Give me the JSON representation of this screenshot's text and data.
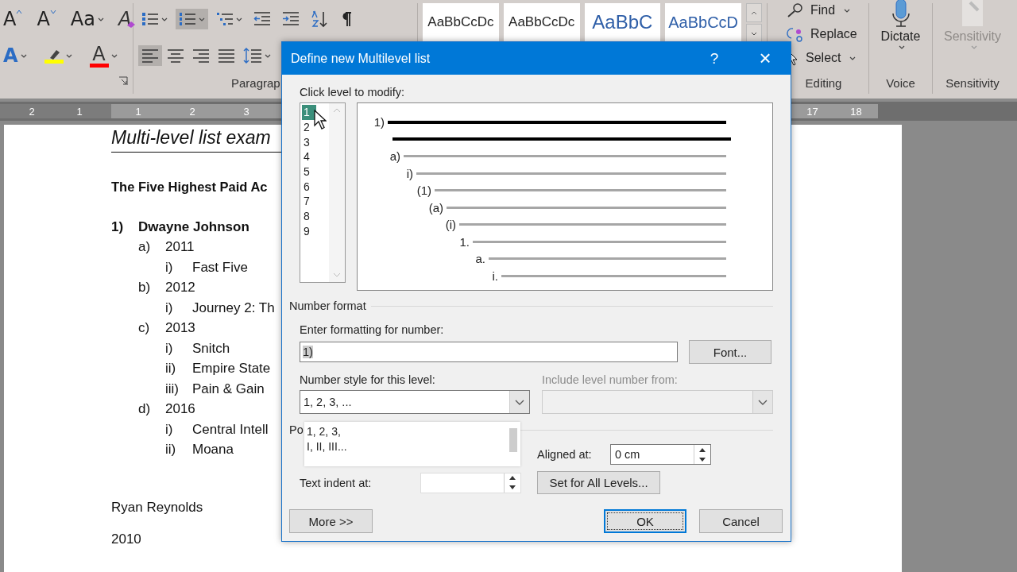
{
  "ribbon": {
    "font_buttons": [
      {
        "kind": "grow",
        "glyph": "A"
      },
      {
        "kind": "shrink",
        "glyph": "A"
      },
      {
        "kind": "case",
        "glyph": "Aa",
        "dropdown": true
      },
      {
        "kind": "clear",
        "glyph": "A"
      }
    ],
    "font_buttons_2": [
      {
        "kind": "effects",
        "glyph": "A",
        "dropdown": true
      },
      {
        "kind": "highlight",
        "dropdown": true,
        "color": "#ffff00"
      },
      {
        "kind": "font-color",
        "glyph": "A",
        "dropdown": true,
        "color": "#ff0000"
      }
    ],
    "paragraph_buttons": [
      {
        "kind": "bullets",
        "selected": false,
        "dropdown": true
      },
      {
        "kind": "numbering",
        "selected": true,
        "dropdown": true
      },
      {
        "kind": "multilevel",
        "selected": false,
        "dropdown": true
      },
      {
        "kind": "outdent",
        "selected": false
      },
      {
        "kind": "indent",
        "selected": false
      },
      {
        "kind": "sort",
        "selected": false
      },
      {
        "kind": "pilcrow",
        "selected": false
      }
    ],
    "paragraph_buttons_2": [
      {
        "kind": "align-left",
        "selected": true
      },
      {
        "kind": "align-center",
        "selected": false
      },
      {
        "kind": "align-right",
        "selected": false
      },
      {
        "kind": "justify",
        "selected": false
      },
      {
        "kind": "line-spacing",
        "selected": false,
        "dropdown": true
      }
    ],
    "paragraph_label": "Paragrap",
    "styles": [
      {
        "sample": "AaBbCcDc",
        "kind": "normal"
      },
      {
        "sample": "AaBbCcDc",
        "kind": "normal"
      },
      {
        "sample": "AaBbC",
        "kind": "heading1"
      },
      {
        "sample": "AaBbCcD",
        "kind": "heading2"
      }
    ],
    "editing": [
      {
        "label": "Find",
        "kind": "find",
        "dropdown": true
      },
      {
        "label": "Replace",
        "kind": "replace"
      },
      {
        "label": "Select",
        "kind": "select",
        "dropdown": true
      }
    ],
    "editing_label": "Editing",
    "dictate": {
      "label": "Dictate",
      "dropdown": true
    },
    "voice_label": "Voice",
    "sensitivity": {
      "label": "Sensitivity",
      "disabled": true,
      "dropdown": true
    },
    "sensitivity_label": "Sensitivity"
  },
  "ruler": {
    "left_numbers": [
      "2",
      "1"
    ],
    "numbers": [
      "1",
      "2",
      "3"
    ],
    "right_numbers": [
      "17",
      "18"
    ]
  },
  "document": {
    "heading": "Multi-level list exam",
    "subheading": "The Five Highest Paid Ac",
    "list": [
      {
        "number": "1)",
        "text": "Dwayne Johnson",
        "children": [
          {
            "number": "a)",
            "text": "2011",
            "children": [
              {
                "number": "i)",
                "text": "Fast Five"
              }
            ]
          },
          {
            "number": "b)",
            "text": "2012",
            "children": [
              {
                "number": "i)",
                "text": "Journey 2: Th"
              }
            ]
          },
          {
            "number": "c)",
            "text": "2013",
            "children": [
              {
                "number": "i)",
                "text": "Snitch"
              },
              {
                "number": "ii)",
                "text": "Empire State"
              },
              {
                "number": "iii)",
                "text": "Pain & Gain"
              }
            ]
          },
          {
            "number": "d)",
            "text": "2016",
            "children": [
              {
                "number": "i)",
                "text": "Central Intell"
              },
              {
                "number": "ii)",
                "text": "Moana"
              }
            ]
          }
        ]
      }
    ],
    "paragraphs": [
      "Ryan Reynolds",
      "2010"
    ]
  },
  "dialog": {
    "title": "Define new Multilevel list",
    "help": "?",
    "close": "×",
    "levels_label": "Click level to modify:",
    "levels": [
      {
        "label": "1",
        "selected": true
      },
      {
        "label": "2",
        "selected": false
      },
      {
        "label": "3",
        "selected": false
      },
      {
        "label": "4",
        "selected": false
      },
      {
        "label": "5",
        "selected": false
      },
      {
        "label": "6",
        "selected": false
      },
      {
        "label": "7",
        "selected": false
      },
      {
        "label": "8",
        "selected": false
      },
      {
        "label": "9",
        "selected": false
      }
    ],
    "preview": [
      "1)",
      "a)",
      "i)",
      "(1)",
      "(a)",
      "(i)",
      "1.",
      "a.",
      "i."
    ],
    "number_format_label": "Number format",
    "format_label": "Enter formatting for number:",
    "format_value": "1)",
    "font_button": "Font...",
    "style_label": "Number style for this level:",
    "style_value": "1, 2, 3, ...",
    "include_label": "Include level number from:",
    "include_disabled": true,
    "position_label": "Po",
    "popup_options": [
      "1, 2, 3,",
      "I, II, III..."
    ],
    "aligned_label": "Aligned at:",
    "aligned_value": "0 cm",
    "indent_label": "Text indent at:",
    "set_all_button": "Set for All Levels...",
    "more_button": "More >>",
    "ok_button": "OK",
    "cancel_button": "Cancel"
  }
}
